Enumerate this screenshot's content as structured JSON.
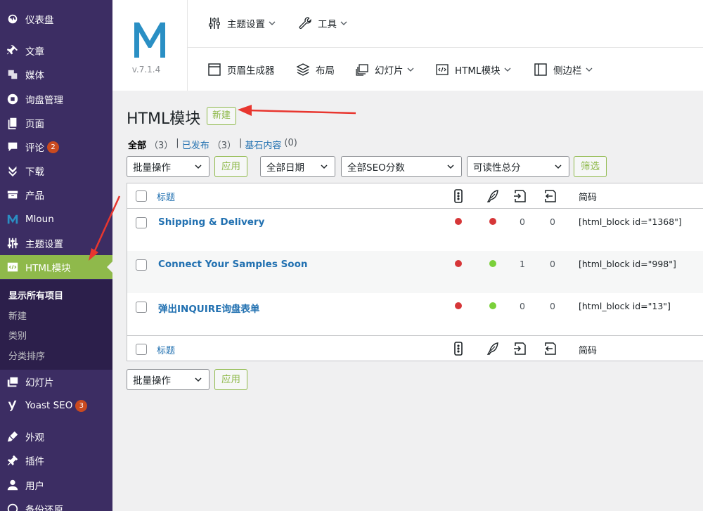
{
  "sidebar": {
    "items": [
      {
        "label": "仪表盘",
        "icon": "dashboard-icon"
      },
      {
        "label": "文章",
        "icon": "pin-icon"
      },
      {
        "label": "媒体",
        "icon": "media-icon"
      },
      {
        "label": "询盘管理",
        "icon": "inquiry-icon"
      },
      {
        "label": "页面",
        "icon": "page-icon"
      },
      {
        "label": "评论",
        "icon": "comment-icon",
        "badge": "2"
      },
      {
        "label": "下载",
        "icon": "download-icon"
      },
      {
        "label": "产品",
        "icon": "product-icon"
      },
      {
        "label": "Mloun",
        "icon": "mloun-logo-icon"
      },
      {
        "label": "主题设置",
        "icon": "sliders-icon"
      },
      {
        "label": "HTML模块",
        "icon": "html-block-icon"
      },
      {
        "label": "幻灯片",
        "icon": "slides-icon"
      },
      {
        "label": "Yoast SEO",
        "icon": "yoast-icon",
        "badge": "3"
      },
      {
        "label": "外观",
        "icon": "brush-icon"
      },
      {
        "label": "插件",
        "icon": "plugin-icon"
      },
      {
        "label": "用户",
        "icon": "user-icon"
      },
      {
        "label": "备份还原",
        "icon": "backup-icon"
      }
    ],
    "submenu": [
      "显示所有项目",
      "新建",
      "类别",
      "分类排序"
    ]
  },
  "header": {
    "version": "v.7.1.4",
    "nav_row1": [
      {
        "label": "主题设置"
      },
      {
        "label": "工具"
      }
    ],
    "nav_row2": [
      {
        "label": "页眉生成器"
      },
      {
        "label": "布局"
      },
      {
        "label": "幻灯片"
      },
      {
        "label": "HTML模块"
      },
      {
        "label": "侧边栏"
      }
    ]
  },
  "main": {
    "title": "HTML模块",
    "add_new": "新建",
    "filters": {
      "all": "全部",
      "all_count": "（3）",
      "sep1": "|",
      "published": "已发布",
      "published_count": "（3）",
      "sep2": "|",
      "cornerstone": "基石内容",
      "cornerstone_count": "(0)"
    },
    "bulk_action": "批量操作",
    "apply": "应用",
    "all_dates": "全部日期",
    "seo_scores": "全部SEO分数",
    "readability": "可读性总分",
    "filter_btn": "筛选",
    "columns": {
      "title": "标题",
      "shortcode": "简码"
    },
    "rows": [
      {
        "title": "Shipping & Delivery",
        "seo": "#d63638",
        "read": "#d63638",
        "links_out": "0",
        "links_in": "0",
        "shortcode": "[html_block id=\"1368\"]"
      },
      {
        "title": "Connect Your Samples Soon",
        "seo": "#d63638",
        "read": "#7ad03a",
        "links_out": "1",
        "links_in": "0",
        "shortcode": "[html_block id=\"998\"]"
      },
      {
        "title": "弹出INQUIRE询盘表单",
        "seo": "#d63638",
        "read": "#7ad03a",
        "links_out": "0",
        "links_in": "0",
        "shortcode": "[html_block id=\"13\"]"
      }
    ]
  },
  "colors": {
    "sidebar": "#3c2d63",
    "accent": "#8fb94b",
    "link": "#2271b1",
    "arrow": "#e8362f"
  }
}
